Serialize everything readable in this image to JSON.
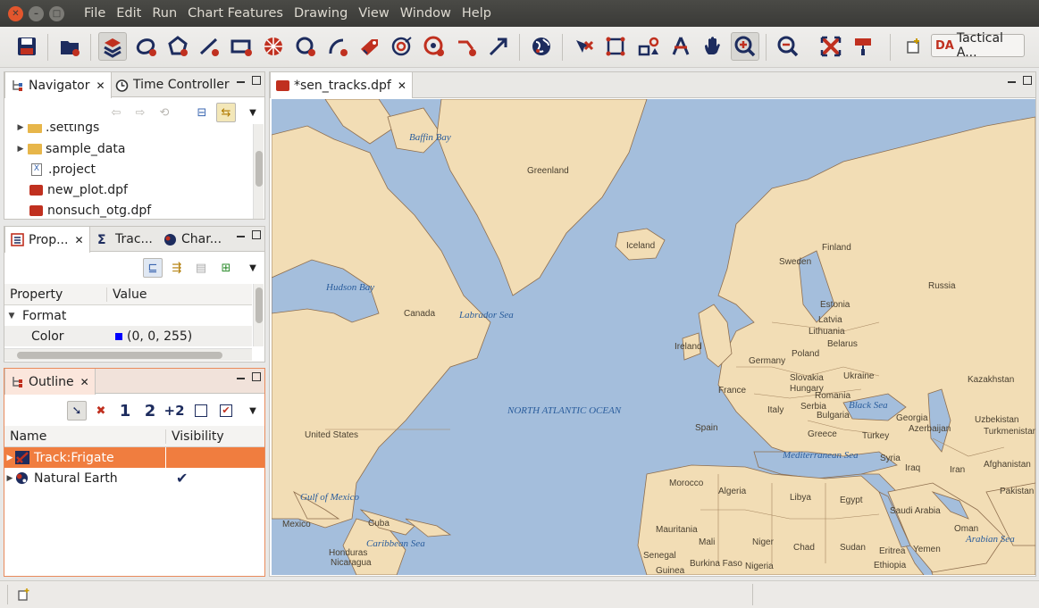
{
  "window": {
    "menu": [
      "File",
      "Edit",
      "Run",
      "Chart Features",
      "Drawing",
      "View",
      "Window",
      "Help"
    ]
  },
  "toolbar": {
    "icons": [
      "save-icon",
      "open-plot-icon",
      "layers-icon",
      "ellipse-icon",
      "polygon-icon",
      "line-icon",
      "rectangle-icon",
      "grid-icon",
      "circle-icon",
      "arc-icon",
      "label-icon",
      "range-rings-icon",
      "bullseye-icon",
      "vector-icon",
      "arrow-icon",
      "globe-icon",
      "select-icon",
      "zoom-rect-icon",
      "shapes-icon",
      "measure-icon",
      "pan-icon",
      "zoom-in-icon",
      "zoom-out-icon",
      "fit-icon",
      "paint-icon"
    ],
    "perspective_logo": "DA",
    "perspective_label": "Tactical A..."
  },
  "navigator": {
    "tab1": "Navigator",
    "tab2": "Time Controller",
    "items": [
      ".settings",
      "sample_data",
      ".project",
      "new_plot.dpf",
      "nonsuch_otg.dpf"
    ]
  },
  "properties": {
    "tab1": "Prop...",
    "tab2": "Trac...",
    "tab3": "Char...",
    "col_property": "Property",
    "col_value": "Value",
    "group": "Format",
    "row_label": "Color",
    "row_value": "(0, 0, 255)",
    "swatch_color": "#0000ff"
  },
  "outline": {
    "tab": "Outline",
    "col_name": "Name",
    "col_visibility": "Visibility",
    "rows": [
      {
        "name": "Track:Frigate",
        "visible": ""
      },
      {
        "name": "Natural Earth",
        "visible": "✔"
      }
    ],
    "tool_labels": [
      "1",
      "2",
      "+2"
    ]
  },
  "editor": {
    "tab": "*sen_tracks.dpf"
  },
  "map": {
    "labels": [
      "Baffin Bay",
      "Greenland",
      "Iceland",
      "Finland",
      "Sweden",
      "Russia",
      "Estonia",
      "Latvia",
      "Lithuania",
      "Belarus",
      "Hudson Bay",
      "Canada",
      "Labrador Sea",
      "Ireland",
      "Germany",
      "Poland",
      "Ukraine",
      "Slovakia",
      "Hungary",
      "Romania",
      "Kazakhstan",
      "France",
      "Serbia",
      "Bulgaria",
      "Black Sea",
      "Italy",
      "Georgia",
      "Azerbaijan",
      "Uzbekistan",
      "NORTH ATLANTIC OCEAN",
      "United States",
      "Spain",
      "Greece",
      "Turkey",
      "Turkmenistan",
      "Mediterranean Sea",
      "Syria",
      "Iraq",
      "Iran",
      "Afghanistan",
      "Gulf of Mexico",
      "Morocco",
      "Algeria",
      "Libya",
      "Egypt",
      "Pakistan",
      "Mexico",
      "Cuba",
      "Saudi Arabia",
      "Oman",
      "Caribbean Sea",
      "Mauritania",
      "Mali",
      "Niger",
      "Chad",
      "Sudan",
      "Eritrea",
      "Yemen",
      "Arabian Sea",
      "Honduras",
      "Nicaragua",
      "Senegal",
      "Burkina Faso",
      "Guinea",
      "Nigeria",
      "Ethiopia"
    ]
  }
}
